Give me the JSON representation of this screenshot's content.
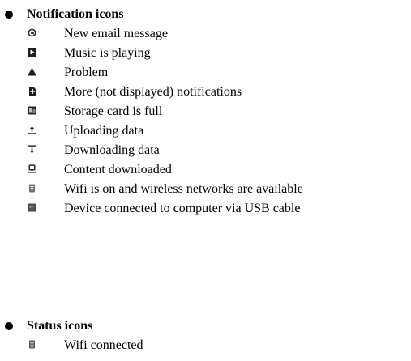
{
  "sections": [
    {
      "title": "Notification icons",
      "items": [
        {
          "icon": "email-at-icon",
          "label": "New email message"
        },
        {
          "icon": "music-play-icon",
          "label": "Music is playing"
        },
        {
          "icon": "warning-triangle-icon",
          "label": "Problem"
        },
        {
          "icon": "more-plus-icon",
          "label": "More (not displayed) notifications"
        },
        {
          "icon": "storage-card-icon",
          "label": "Storage card is full"
        },
        {
          "icon": "upload-icon",
          "label": "Uploading data"
        },
        {
          "icon": "download-icon",
          "label": "Downloading data"
        },
        {
          "icon": "content-downloaded-icon",
          "label": "Content downloaded"
        },
        {
          "icon": "wifi-available-icon",
          "label": "Wifi is on and wireless networks are available"
        },
        {
          "icon": "usb-connected-icon",
          "label": "Device connected to computer via USB cable"
        }
      ]
    },
    {
      "title": "Status icons",
      "items": [
        {
          "icon": "wifi-connected-icon",
          "label": "Wifi connected"
        }
      ]
    }
  ]
}
